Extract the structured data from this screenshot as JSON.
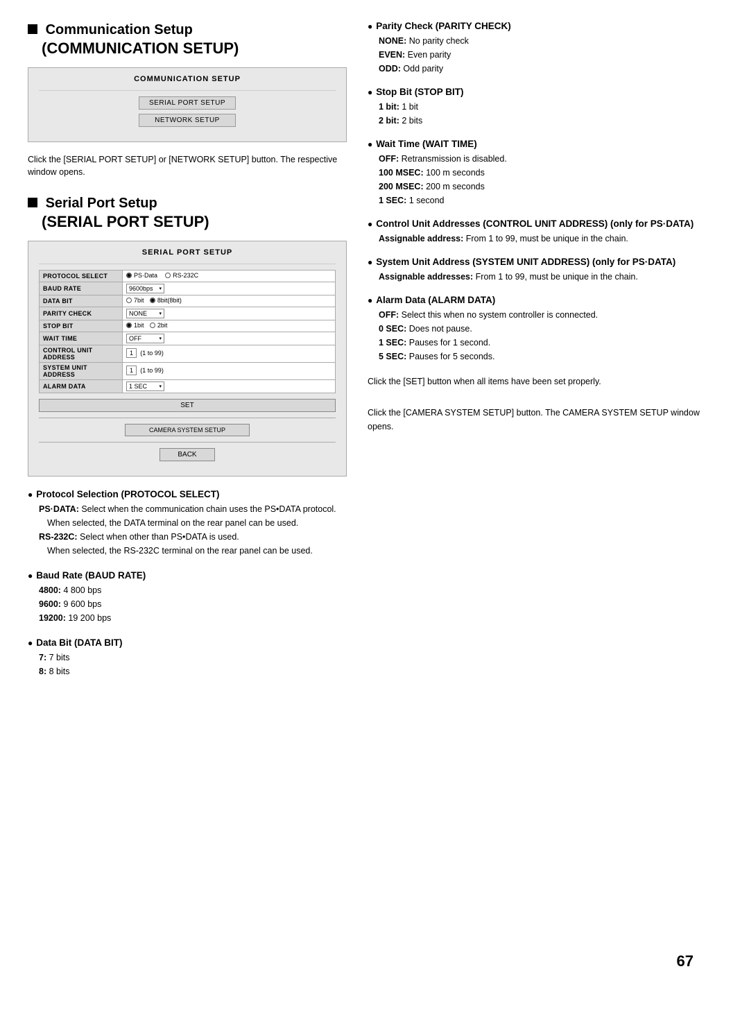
{
  "comm_setup": {
    "section_title_line1": "Communication Setup",
    "section_title_line2": "(COMMUNICATION SETUP)",
    "ui_title": "COMMUNICATION SETUP",
    "btn_serial": "SERIAL PORT SETUP",
    "btn_network": "NETWORK SETUP",
    "intro": "Click the [SERIAL PORT SETUP] or [NETWORK SETUP] button. The respective window opens."
  },
  "serial_setup": {
    "section_title_line1": "Serial Port Setup",
    "section_title_line2": "(SERIAL PORT SETUP)",
    "ui_title": "SERIAL PORT SETUP",
    "form_rows": [
      {
        "label": "PROTOCOL SELECT",
        "value": "PS·Data  RS-232C"
      },
      {
        "label": "BAUD RATE",
        "value": "9600bps ▾"
      },
      {
        "label": "DATA BIT",
        "value": "8bit(8bit)"
      },
      {
        "label": "PARITY CHECK",
        "value": "NONE ▾"
      },
      {
        "label": "STOP BIT",
        "value": "1bit  2bit"
      },
      {
        "label": "WAIT TIME",
        "value": "OFF ▾"
      },
      {
        "label": "CONTROL UNIT ADDRESS",
        "value": "1   (1 to 99)"
      },
      {
        "label": "SYSTEM UNIT ADDRESS",
        "value": "1   (1 to 99)"
      },
      {
        "label": "ALARM DATA",
        "value": "1 SEC ▾"
      }
    ],
    "btn_set": "SET",
    "btn_camera": "CAMERA SYSTEM SETUP",
    "btn_back": "BACK"
  },
  "bullet_sections_left": [
    {
      "heading": "Protocol Selection (PROTOCOL SELECT)",
      "items": [
        {
          "term": "PS·DATA:",
          "text": "Select when the communication chain uses the PS•DATA protocol.",
          "sub": "When selected, the DATA terminal on the rear panel can be used."
        },
        {
          "term": "RS-232C:",
          "text": "Select when other than PS•DATA is used.",
          "sub": "When selected, the RS-232C terminal on the rear panel can be used."
        }
      ]
    },
    {
      "heading": "Baud Rate (BAUD RATE)",
      "items": [
        {
          "term": "4800:",
          "text": "4 800 bps"
        },
        {
          "term": "9600:",
          "text": "9 600 bps"
        },
        {
          "term": "19200:",
          "text": "19 200 bps"
        }
      ]
    },
    {
      "heading": "Data Bit (DATA BIT)",
      "items": [
        {
          "term": "7:",
          "text": "7 bits"
        },
        {
          "term": "8:",
          "text": "8 bits"
        }
      ]
    }
  ],
  "bullet_sections_right": [
    {
      "heading": "Parity Check (PARITY CHECK)",
      "items": [
        {
          "term": "NONE:",
          "text": "No parity check"
        },
        {
          "term": "EVEN:",
          "text": "Even parity"
        },
        {
          "term": "ODD:",
          "text": "Odd parity"
        }
      ]
    },
    {
      "heading": "Stop Bit (STOP BIT)",
      "items": [
        {
          "term": "1 bit:",
          "text": "1 bit"
        },
        {
          "term": "2 bit:",
          "text": "2 bits"
        }
      ]
    },
    {
      "heading": "Wait Time (WAIT TIME)",
      "items": [
        {
          "term": "OFF:",
          "text": "Retransmission is disabled."
        },
        {
          "term": "100 MSEC:",
          "text": "100 m seconds"
        },
        {
          "term": "200 MSEC:",
          "text": "200 m seconds"
        },
        {
          "term": "1 SEC:",
          "text": "1 second"
        }
      ]
    },
    {
      "heading": "Control Unit Addresses (CONTROL UNIT ADDRESS) (only for PS·DATA)",
      "items": [
        {
          "term": "Assignable address:",
          "text": "From 1 to 99, must be unique in the chain."
        }
      ]
    },
    {
      "heading": "System Unit Address (SYSTEM UNIT ADDRESS) (only for PS·DATA)",
      "items": [
        {
          "term": "Assignable addresses:",
          "text": "From 1 to 99, must be unique in the chain."
        }
      ]
    },
    {
      "heading": "Alarm Data (ALARM DATA)",
      "items": [
        {
          "term": "OFF:",
          "text": "Select this when no system controller is connected."
        },
        {
          "term": "0 SEC:",
          "text": "Does not pause."
        },
        {
          "term": "1 SEC:",
          "text": "Pauses for 1 second."
        },
        {
          "term": "5 SEC:",
          "text": "Pauses for 5 seconds."
        }
      ]
    }
  ],
  "bottom_notes": [
    "Click the [SET] button when all items have been set properly.",
    "Click the [CAMERA SYSTEM SETUP] button. The CAMERA SYSTEM SETUP window opens."
  ],
  "page_number": "67"
}
